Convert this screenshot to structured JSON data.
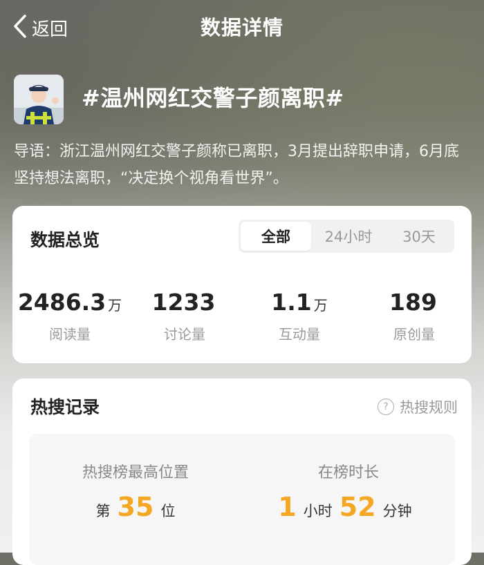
{
  "header": {
    "back_label": "返回",
    "title": "数据详情"
  },
  "topic": {
    "title": "#温州网红交警子颜离职#",
    "intro": "导语：浙江温州网红交警子颜称已离职，3月提出辞职申请，6月底坚持想法离职，“决定换个视角看世界”。"
  },
  "overview": {
    "title": "数据总览",
    "tabs": [
      {
        "label": "全部",
        "active": true
      },
      {
        "label": "24小时",
        "active": false
      },
      {
        "label": "30天",
        "active": false
      }
    ],
    "stats": [
      {
        "value": "2486.3",
        "unit": "万",
        "label": "阅读量"
      },
      {
        "value": "1233",
        "unit": "",
        "label": "讨论量"
      },
      {
        "value": "1.1",
        "unit": "万",
        "label": "互动量"
      },
      {
        "value": "189",
        "unit": "",
        "label": "原创量"
      }
    ]
  },
  "hot_search": {
    "title": "热搜记录",
    "rules_label": "热搜规则",
    "help_glyph": "?",
    "peak": {
      "label": "热搜榜最高位置",
      "prefix": "第",
      "value": "35",
      "suffix": "位"
    },
    "duration": {
      "label": "在榜时长",
      "hours": "1",
      "hours_unit": "小时",
      "minutes": "52",
      "minutes_unit": "分钟"
    }
  },
  "colors": {
    "accent_orange": "#f5a623",
    "card_bg": "#ffffff",
    "muted_text": "#999999"
  }
}
